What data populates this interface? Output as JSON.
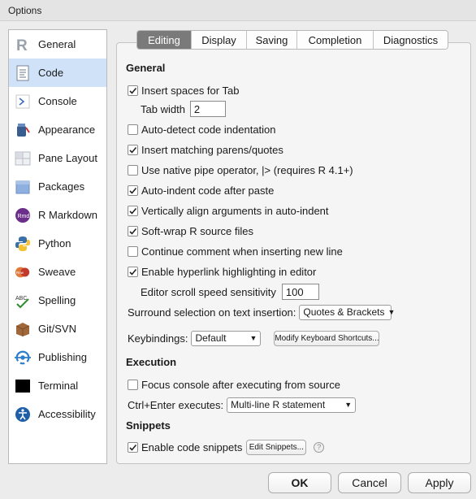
{
  "window": {
    "title": "Options"
  },
  "sidebar": {
    "items": [
      {
        "label": "General",
        "icon": "r-logo-icon"
      },
      {
        "label": "Code",
        "icon": "code-page-icon",
        "selected": true
      },
      {
        "label": "Console",
        "icon": "console-prompt-icon"
      },
      {
        "label": "Appearance",
        "icon": "paint-bucket-icon"
      },
      {
        "label": "Pane Layout",
        "icon": "pane-layout-icon"
      },
      {
        "label": "Packages",
        "icon": "package-box-icon"
      },
      {
        "label": "R Markdown",
        "icon": "rmd-icon"
      },
      {
        "label": "Python",
        "icon": "python-icon"
      },
      {
        "label": "Sweave",
        "icon": "sweave-icon"
      },
      {
        "label": "Spelling",
        "icon": "spelling-check-icon"
      },
      {
        "label": "Git/SVN",
        "icon": "git-box-icon"
      },
      {
        "label": "Publishing",
        "icon": "publishing-icon"
      },
      {
        "label": "Terminal",
        "icon": "terminal-icon"
      },
      {
        "label": "Accessibility",
        "icon": "accessibility-icon"
      }
    ]
  },
  "tabs": [
    {
      "label": "Editing",
      "active": true
    },
    {
      "label": "Display"
    },
    {
      "label": "Saving"
    },
    {
      "label": "Completion"
    },
    {
      "label": "Diagnostics"
    }
  ],
  "editing": {
    "general_heading": "General",
    "insert_spaces": {
      "label": "Insert spaces for Tab",
      "checked": true
    },
    "tab_width": {
      "label": "Tab width",
      "value": "2"
    },
    "auto_detect": {
      "label": "Auto-detect code indentation",
      "checked": false
    },
    "matching_parens": {
      "label": "Insert matching parens/quotes",
      "checked": true
    },
    "native_pipe": {
      "label": "Use native pipe operator, |> (requires R 4.1+)",
      "checked": false
    },
    "auto_indent": {
      "label": "Auto-indent code after paste",
      "checked": true
    },
    "vertical_align": {
      "label": "Vertically align arguments in auto-indent",
      "checked": true
    },
    "soft_wrap": {
      "label": "Soft-wrap R source files",
      "checked": true
    },
    "continue_comment": {
      "label": "Continue comment when inserting new line",
      "checked": false
    },
    "hyperlink": {
      "label": "Enable hyperlink highlighting in editor",
      "checked": true
    },
    "scroll_speed": {
      "label": "Editor scroll speed sensitivity",
      "value": "100"
    },
    "surround": {
      "label": "Surround selection on text insertion:",
      "value": "Quotes & Brackets"
    },
    "keybindings": {
      "label": "Keybindings:",
      "value": "Default",
      "modify_button": "Modify Keyboard Shortcuts..."
    },
    "execution_heading": "Execution",
    "focus_console": {
      "label": "Focus console after executing from source",
      "checked": false
    },
    "ctrl_enter": {
      "label": "Ctrl+Enter executes:",
      "value": "Multi-line R statement"
    },
    "snippets_heading": "Snippets",
    "enable_snippets": {
      "label": "Enable code snippets",
      "checked": true
    },
    "edit_snippets_button": "Edit Snippets...",
    "help_glyph": "?"
  },
  "footer": {
    "ok": "OK",
    "cancel": "Cancel",
    "apply": "Apply"
  },
  "colors": {
    "selected_bg": "#cfe2f8",
    "active_tab": "#7a7a7a",
    "window_bg": "#ececec"
  }
}
